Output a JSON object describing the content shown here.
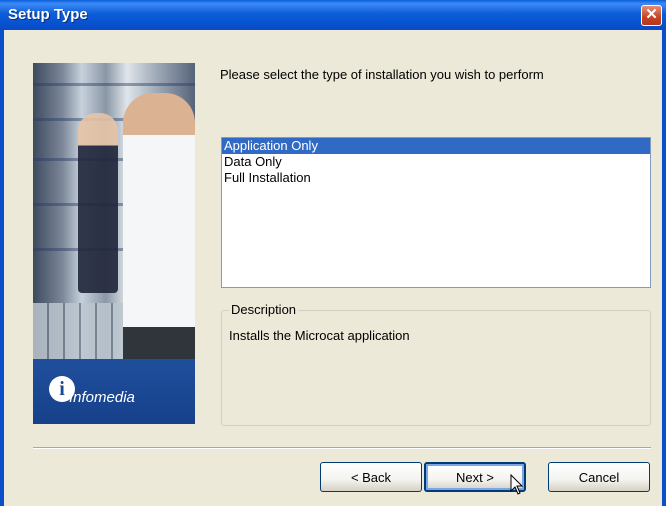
{
  "window": {
    "title": "Setup Type",
    "close_symbol": "✕"
  },
  "side_panel": {
    "brand_logo": "i",
    "brand_name": "Infomedia"
  },
  "prompt": "Please select the type of installation you wish to perform",
  "install_types": [
    {
      "label": "Application Only",
      "selected": true
    },
    {
      "label": "Data Only",
      "selected": false
    },
    {
      "label": "Full Installation",
      "selected": false
    }
  ],
  "description": {
    "label": "Description",
    "text": "Installs the Microcat application"
  },
  "buttons": {
    "back": "< Back",
    "next": "Next >",
    "cancel": "Cancel"
  },
  "colors": {
    "titlebar": "#0a5fd8",
    "selection": "#316ac5",
    "dialog_bg": "#ece9d8"
  }
}
